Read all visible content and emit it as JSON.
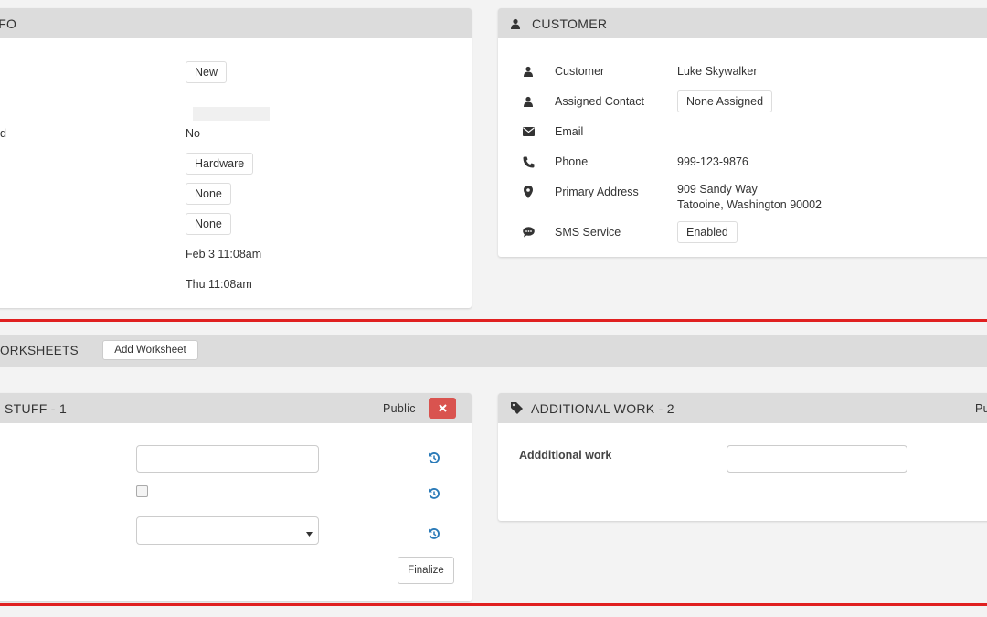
{
  "info_panel": {
    "title": "IFO",
    "status": "New",
    "row3_label": "d",
    "row3_value": "No",
    "type": "Hardware",
    "value_none_1": "None",
    "value_none_2": "None",
    "date_1": "Feb 3 11:08am",
    "date_2": "Thu 11:08am"
  },
  "customer_panel": {
    "title": "CUSTOMER",
    "rows": [
      {
        "icon": "user-icon",
        "label": "Customer",
        "value": "Luke Skywalker"
      },
      {
        "icon": "user-icon",
        "label": "Assigned Contact",
        "value": "None Assigned"
      },
      {
        "icon": "envelope-icon",
        "label": "Email",
        "value": ""
      },
      {
        "icon": "phone-icon",
        "label": "Phone",
        "value": "999-123-9876"
      },
      {
        "icon": "map-marker-icon",
        "label": "Primary Address",
        "value": "909 Sandy Way",
        "value2": "Tatooine, Washington 90002"
      },
      {
        "icon": "chat-icon",
        "label": "SMS Service",
        "value": "Enabled"
      }
    ]
  },
  "worksheets_bar": {
    "title": "ORKSHEETS",
    "add_button": "Add Worksheet"
  },
  "worksheet_1": {
    "title": "STUFF - 1",
    "visibility": "Public",
    "delete_icon": "times-icon",
    "finalize_button": "Finalize",
    "reset_icon": "history-icon"
  },
  "worksheet_2": {
    "title": "ADDITIONAL WORK - 2",
    "visibility": "Pu",
    "field_label": "Addditional work",
    "icon": "tag-icon"
  },
  "colors": {
    "accent_link": "#2a7ab8",
    "header_bg": "#dcdcdc",
    "danger": "#d9534f",
    "highlight_line": "#e02020"
  }
}
